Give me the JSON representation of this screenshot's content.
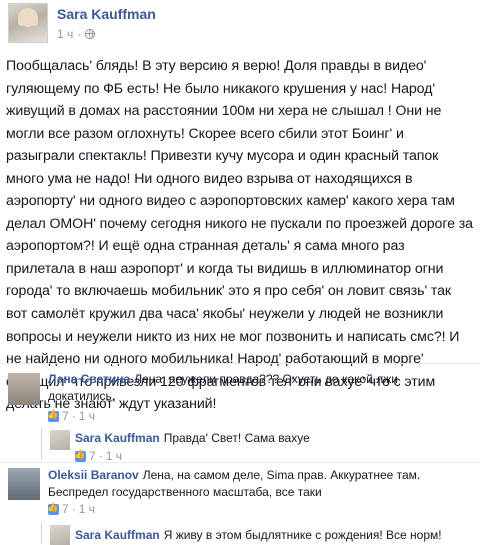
{
  "post": {
    "author": "Sara Kauffman",
    "time": "1 ч",
    "privacy_icon": "globe-icon",
    "text": "Пообщалась' блядь! В эту версию я верю! Доля правды в видео' гуляющему по ФБ есть! Не было никакого крушения у нас! Народ' живущий в домах на расстоянии 100м ни хера не слышал ! Они не могли все разом оглохнуть! Скорее всего сбили этот Боинг' и разыграли спектакль! Привезти кучу мусора и один красный тапок много ума не надо! Ни одного видео взрыва от находящихся в аэропорту' ни одного видео с аэропортовских камер' какого хера там делал ОМОН' почему сегодня никого не пускали по проезжей дороге за аэропортом?! И ещё одна странная деталь' я сама много раз прилетала в наш аэропорт' и когда ты видишь в иллюминатор огни города' то включаешь мобильник' это я про себя' он ловит связь' так вот самолёт кружил два часа' якобы' неужели у людей не возникли вопросы и неужели никто из них не мог позвонить и написать смс?! И не найдено ни одного мобильника! Народ' работающий в морге' сообщил' что привезли 120 фрагментов тел' они вахуе' что с этим делать не знают' ждут указаний!"
  },
  "comments": [
    {
      "author": "Лана Светина",
      "text": "Лена, неужели правда??? Охуеть до какой лжи докатились.",
      "likes": "7",
      "time": "1 ч",
      "reply": {
        "author": "Sara Kauffman",
        "text": "Правда' Свет! Сама вахуе",
        "likes": "7",
        "time": "1 ч"
      }
    },
    {
      "author": "Oleksii Baranov",
      "text": "Лена, на самом деле, Sima прав. Аккуратнее там. Беспредел государственного масштаба, все таки",
      "likes": "7",
      "time": "1 ч",
      "reply": {
        "author": "Sara Kauffman",
        "text": "Я живу в этом быдлятнике с рождения! Все норм!",
        "likes": "",
        "time": ""
      }
    }
  ],
  "colors": {
    "link": "#3b5998",
    "meta": "#9197a3",
    "like": "#5890ff"
  }
}
